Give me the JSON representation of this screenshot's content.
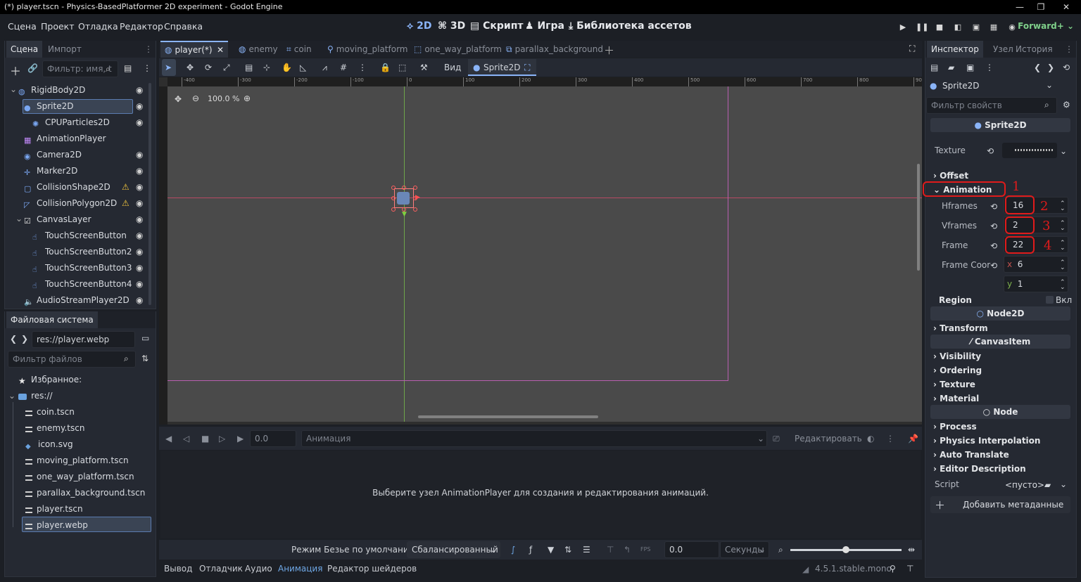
{
  "window": {
    "title": "(*) player.tscn - Physics-BasedPlatformer 2D experiment - Godot Engine"
  },
  "menu": [
    "Сцена",
    "Проект",
    "Отладка",
    "Редактор",
    "Справка"
  ],
  "workspaces": {
    "w2d": "2D",
    "w3d": "3D",
    "script": "Скрипт",
    "game": "Игра",
    "assetlib": "Библиотека ассетов"
  },
  "renderer": "Forward+",
  "scene_dock": {
    "tabs": [
      "Сцена",
      "Импорт"
    ],
    "filter_placeholder": "Фильтр: имя, t",
    "nodes": [
      {
        "name": "RigidBody2D",
        "icon": "rigidbody-icon"
      },
      {
        "name": "Sprite2D",
        "icon": "sprite-icon"
      },
      {
        "name": "CPUParticles2D",
        "icon": "particles-icon"
      },
      {
        "name": "AnimationPlayer",
        "icon": "animation-player-icon"
      },
      {
        "name": "Camera2D",
        "icon": "camera-icon"
      },
      {
        "name": "Marker2D",
        "icon": "marker-icon"
      },
      {
        "name": "CollisionShape2D",
        "icon": "collision-shape-icon"
      },
      {
        "name": "CollisionPolygon2D",
        "icon": "collision-polygon-icon"
      },
      {
        "name": "CanvasLayer",
        "icon": "canvas-layer-icon"
      },
      {
        "name": "TouchScreenButton",
        "icon": "touch-button-icon"
      },
      {
        "name": "TouchScreenButton2",
        "icon": "touch-button-icon"
      },
      {
        "name": "TouchScreenButton3",
        "icon": "touch-button-icon"
      },
      {
        "name": "TouchScreenButton4",
        "icon": "touch-button-icon"
      },
      {
        "name": "AudioStreamPlayer2D",
        "icon": "audio-icon"
      }
    ]
  },
  "filesystem": {
    "title": "Файловая система",
    "path": "res://player.webp",
    "filter_placeholder": "Фильтр файлов",
    "favorites": "Избранное:",
    "root": "res://",
    "files": [
      "coin.tscn",
      "enemy.tscn",
      "icon.svg",
      "moving_platform.tscn",
      "one_way_platform.tscn",
      "parallax_background.tscn",
      "player.tscn",
      "player.webp"
    ]
  },
  "editor_tabs": [
    "player(*)",
    "enemy",
    "coin",
    "moving_platform",
    "one_way_platform",
    "parallax_background"
  ],
  "toolbar": {
    "view": "Вид",
    "selected_node": "Sprite2D"
  },
  "viewport": {
    "zoom": "100.0 %",
    "ruler_ticks": [
      "-400",
      "-300",
      "-200",
      "-100",
      "0",
      "100",
      "200",
      "300",
      "400",
      "500",
      "600",
      "700",
      "800",
      "900"
    ]
  },
  "animation_panel": {
    "time": "0.0",
    "anim_placeholder": "Анимация",
    "edit": "Редактировать",
    "message": "Выберите узел AnimationPlayer для создания и редактирования анимаций.",
    "bezier_label": "Режим Безье по умолчанию:",
    "bezier_value": "Сбалансированный",
    "step": "0.0",
    "units": "Секунды",
    "fps": "FPS"
  },
  "bottom_tabs": [
    "Вывод",
    "Отладчик",
    "Аудио",
    "Анимация",
    "Редактор шейдеров"
  ],
  "version": "4.5.1.stable.mono",
  "inspector": {
    "tabs": [
      "Инспектор",
      "Узел",
      "История"
    ],
    "object": "Sprite2D",
    "filter_placeholder": "Фильтр свойств",
    "class_sprite": "Sprite2D",
    "texture_label": "Texture",
    "offset": "Offset",
    "animation": "Animation",
    "hframes_label": "Hframes",
    "hframes": "16",
    "vframes_label": "Vframes",
    "vframes": "2",
    "frame_label": "Frame",
    "frame": "22",
    "frame_coords_label": "Frame Coor",
    "frame_x_label": "x",
    "frame_x": "6",
    "frame_y_label": "y",
    "frame_y": "1",
    "region": "Region",
    "region_toggle": "Вкл",
    "class_node2d": "Node2D",
    "transform": "Transform",
    "class_canvasitem": "CanvasItem",
    "visibility": "Visibility",
    "ordering": "Ordering",
    "texture": "Texture",
    "material": "Material",
    "class_node": "Node",
    "process": "Process",
    "physics_interpolation": "Physics Interpolation",
    "auto_translate": "Auto Translate",
    "editor_description": "Editor Description",
    "script_label": "Script",
    "script_value": "<пусто>",
    "add_metadata": "Добавить метаданные"
  },
  "annotations": [
    "1",
    "2",
    "3",
    "4"
  ],
  "colors": {
    "accent": "#8ab4f8",
    "annotation": "#e01b1b",
    "renderer": "#7fd08a",
    "viewport_bg": "#4a4a4a"
  }
}
